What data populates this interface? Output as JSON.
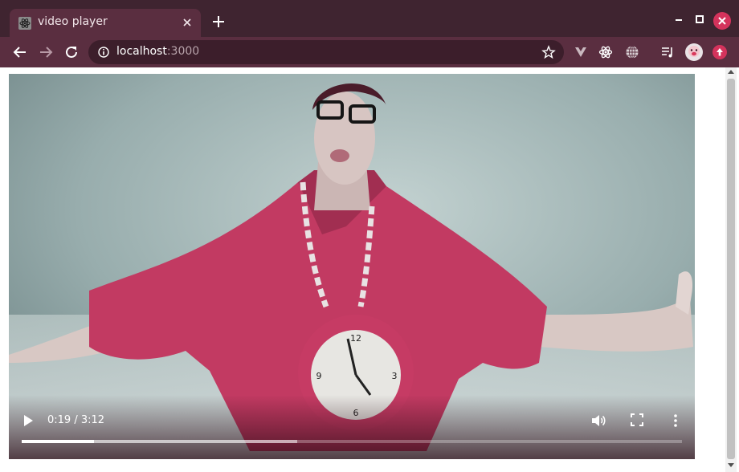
{
  "browser": {
    "tab": {
      "title": "video player",
      "favicon": "react-favicon-icon"
    },
    "address": {
      "host": "localhost",
      "port": ":3000"
    },
    "colors": {
      "frame": "#3f2430",
      "toolbar": "#5a2e40",
      "omnibox": "#3c1e2b",
      "close": "#d4335c"
    }
  },
  "video": {
    "current_time": "0:19",
    "duration": "3:12",
    "time_display": "0:19 / 3:12",
    "played_fraction": 0.109,
    "buffered_fraction": 0.417,
    "scene": "man-in-red-shirt-with-clock-necklace",
    "colors": {
      "shirt": "#c23a62",
      "background": "#9fb3b3",
      "clock": "#c63b64"
    }
  },
  "icons": [
    "back-icon",
    "forward-icon",
    "reload-icon",
    "info-icon",
    "star-icon",
    "vue-devtools-icon",
    "react-devtools-icon",
    "globe-icon",
    "media-queue-icon",
    "profile-avatar-icon",
    "update-icon",
    "play-icon",
    "volume-icon",
    "fullscreen-icon",
    "more-options-icon"
  ]
}
